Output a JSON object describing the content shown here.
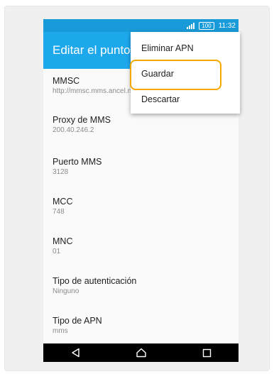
{
  "status_bar": {
    "battery": "100",
    "time": "11:32"
  },
  "app_bar": {
    "title": "Editar el punto de acceso"
  },
  "settings": [
    {
      "title": "MMSC",
      "value": "http://mmsc.mms.ancel.net"
    },
    {
      "title": "Proxy de MMS",
      "value": "200.40.246.2"
    },
    {
      "title": "Puerto MMS",
      "value": "3128"
    },
    {
      "title": "MCC",
      "value": "748"
    },
    {
      "title": "MNC",
      "value": "01"
    },
    {
      "title": "Tipo de autenticación",
      "value": "Ninguno"
    },
    {
      "title": "Tipo de APN",
      "value": "mms"
    }
  ],
  "overflow_menu": {
    "items": [
      "Eliminar APN",
      "Guardar",
      "Descartar"
    ],
    "highlighted_item": "Guardar",
    "highlight_color": "#f5a800"
  },
  "nav_bar": {
    "icons": [
      "back-icon",
      "home-icon",
      "recents-icon"
    ]
  },
  "colors": {
    "status_bar": "#199bd9",
    "app_bar": "#1ea8ec"
  }
}
